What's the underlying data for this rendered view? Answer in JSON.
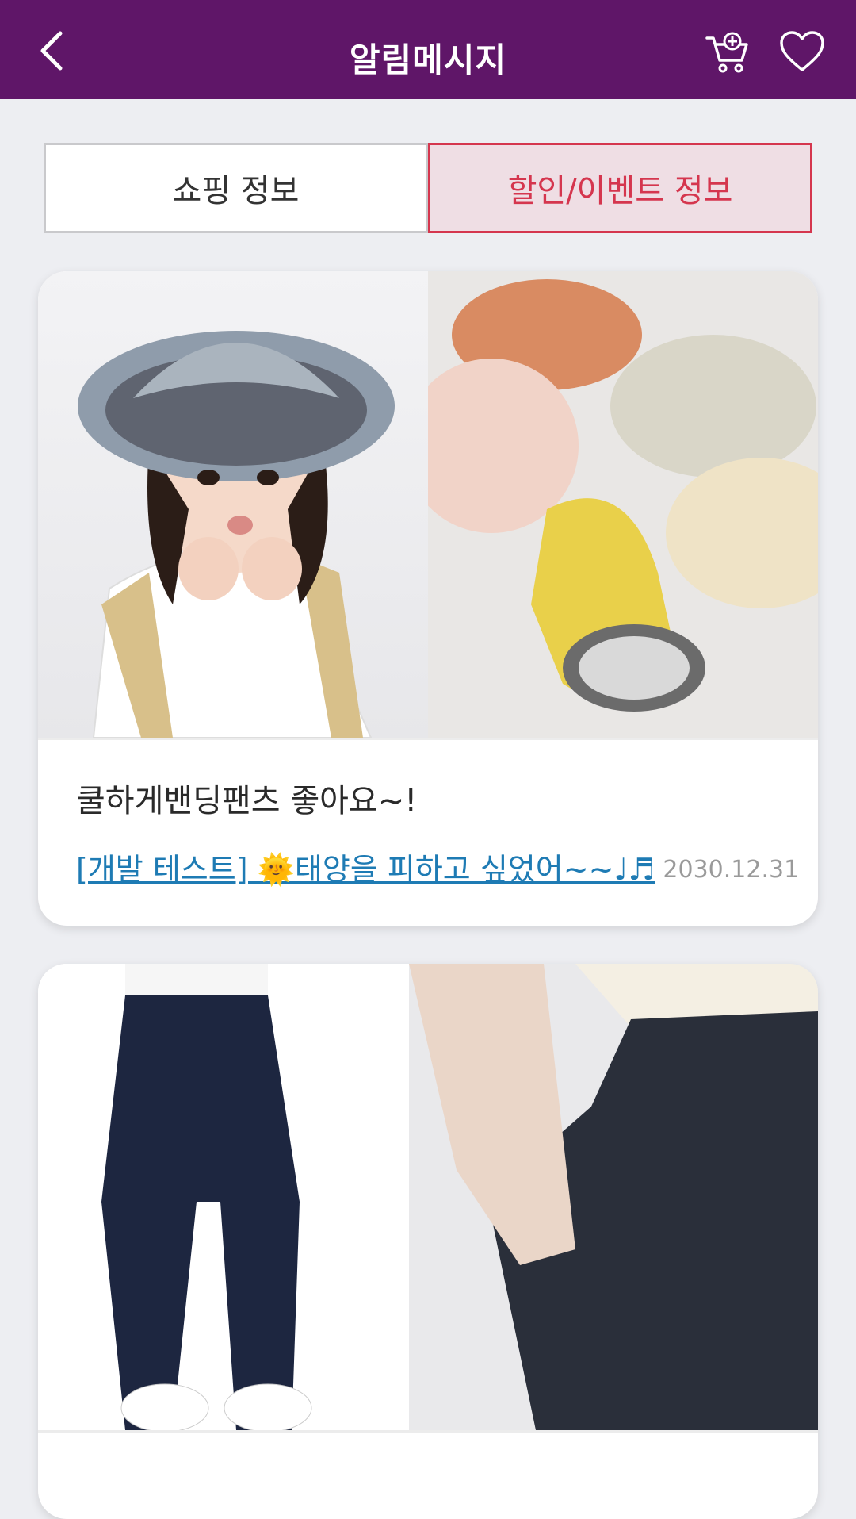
{
  "header": {
    "title": "알림메시지",
    "background_color": "#5f1668",
    "back_icon": "chevron-left-icon",
    "cart_icon": "cart-plus-icon",
    "wishlist_icon": "heart-icon"
  },
  "tabs": [
    {
      "label": "쇼핑 정보",
      "active": false
    },
    {
      "label": "할인/이벤트 정보",
      "active": true
    }
  ],
  "accent_color": "#d5364e",
  "cards": [
    {
      "title": "쿨하게밴딩팬츠 좋아요~!",
      "link": "[개발 테스트] 🌞태양을 피하고 싶었어~~♩♬",
      "date": "2030.12.31",
      "images": [
        "girl-with-bucket-hat-photo",
        "folded-bucket-hats-photo"
      ]
    },
    {
      "title": "",
      "link": "",
      "date": "",
      "images": [
        "navy-banding-pants-photo",
        "stretch-pants-detail-photo"
      ]
    }
  ]
}
